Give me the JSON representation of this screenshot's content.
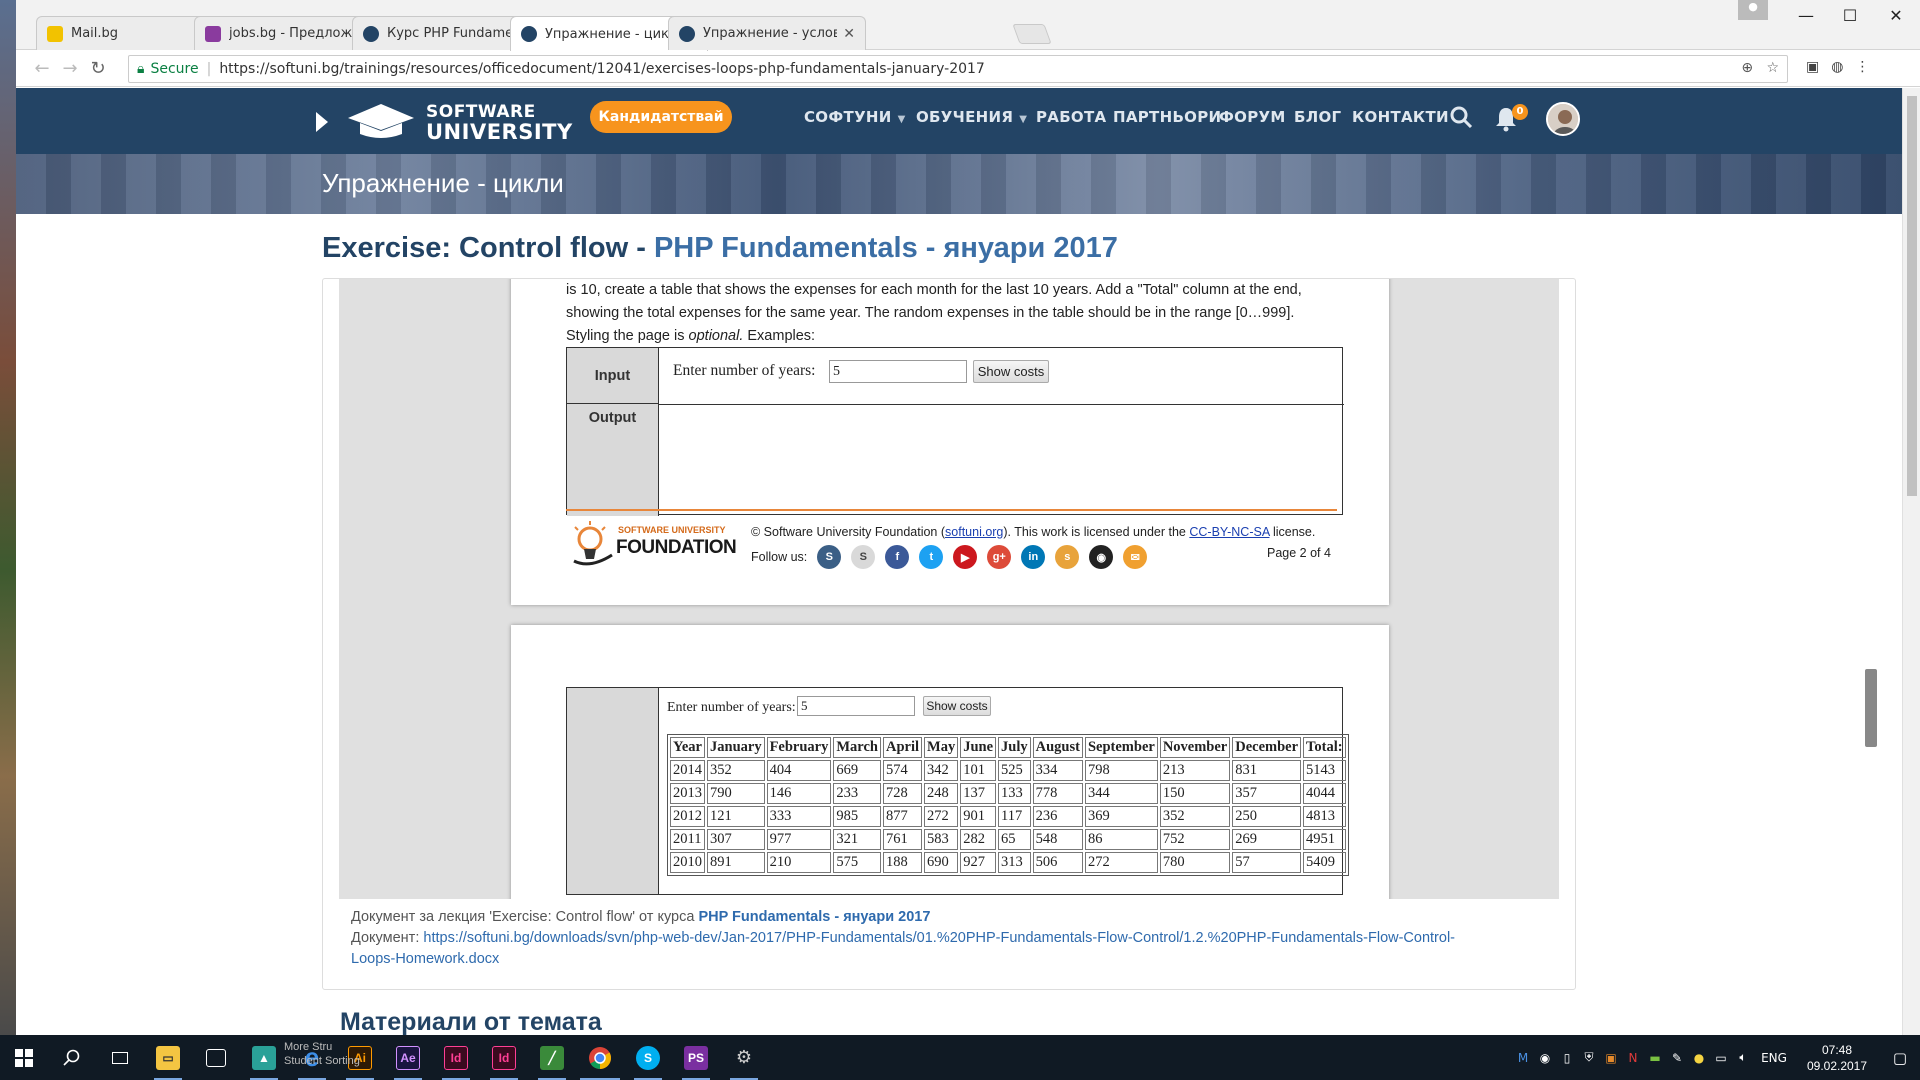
{
  "browser": {
    "tabs": [
      {
        "title": "Mail.bg",
        "color": "#f2c200"
      },
      {
        "title": "jobs.bg - Предложения",
        "color": "#8a3b9e"
      },
      {
        "title": "Курс PHP Fundamentals",
        "color": "#234465"
      },
      {
        "title": "Упражнение - цикли - С",
        "color": "#234465"
      },
      {
        "title": "Упражнение - условни",
        "color": "#234465"
      }
    ],
    "secure_label": "Secure",
    "url": "https://softuni.bg/trainings/resources/officedocument/12041/exercises-loops-php-fundamentals-january-2017"
  },
  "site": {
    "logo_line1": "SOFTWARE",
    "logo_line2": "UNIVERSITY",
    "apply_button": "Кандидатствай",
    "nav": [
      {
        "label": "СОФТУНИ",
        "dropdown": true
      },
      {
        "label": "ОБУЧЕНИЯ",
        "dropdown": true
      },
      {
        "label": "РАБОТА",
        "dropdown": false
      },
      {
        "label": "ПАРТНЬОРИ",
        "dropdown": false
      },
      {
        "label": "ФОРУМ",
        "dropdown": false
      },
      {
        "label": "БЛОГ",
        "dropdown": false
      },
      {
        "label": "КОНТАКТИ",
        "dropdown": false
      }
    ],
    "notification_count": "0",
    "banner_title": "Упражнение - цикли",
    "accent": "#f7941d",
    "header_bg": "#234465"
  },
  "page": {
    "heading_prefix": "Exercise: Control flow - ",
    "heading_course": "PHP Fundamentals - януари 2017"
  },
  "doc": {
    "page2": {
      "text_line_cut": "is 10, create a table that shows the expenses for each month for the last 10 years. Add a \"Total\" column at the end,",
      "text_line1": "showing the total expenses for the same year. The random expenses in the table should be in the range [0…999].",
      "text_line2_a": "Styling the page is ",
      "text_line2_em": "optional.",
      "text_line2_b": " Examples:",
      "input_label": "Input",
      "output_label": "Output",
      "years_label": "Enter number of years:",
      "years_value": "5",
      "button": "Show costs",
      "foundation_l1": "SOFTWARE UNIVERSITY",
      "foundation_l2": "FOUNDATION",
      "copyright_a": "© Software University Foundation (",
      "copyright_link1": "softuni.org",
      "copyright_b": "). This work is licensed under the ",
      "copyright_link2": "CC-BY-NC-SA",
      "copyright_c": " license.",
      "follow_us": "Follow us:",
      "page_number": "Page 2 of 4",
      "social": [
        {
          "name": "softuni-icon",
          "color": "#3b5f86",
          "glyph": "S"
        },
        {
          "name": "softuni-alt-icon",
          "color": "#d9d9d9",
          "glyph": "S"
        },
        {
          "name": "facebook-icon",
          "color": "#3b5998",
          "glyph": "f"
        },
        {
          "name": "twitter-icon",
          "color": "#1da1f2",
          "glyph": "t"
        },
        {
          "name": "youtube-icon",
          "color": "#cc181e",
          "glyph": "▶"
        },
        {
          "name": "google-plus-icon",
          "color": "#dd4b39",
          "glyph": "g+"
        },
        {
          "name": "linkedin-icon",
          "color": "#0077b5",
          "glyph": "in"
        },
        {
          "name": "slideshare-icon",
          "color": "#e8a33b",
          "glyph": "s"
        },
        {
          "name": "github-icon",
          "color": "#222222",
          "glyph": "◉"
        },
        {
          "name": "email-icon",
          "color": "#f0a030",
          "glyph": "✉"
        }
      ]
    },
    "page3": {
      "years_label": "Enter number of years:",
      "years_value": "5",
      "button": "Show costs",
      "table_headers": [
        "Year",
        "January",
        "February",
        "March",
        "April",
        "May",
        "June",
        "July",
        "August",
        "September",
        "November",
        "December",
        "Total:"
      ],
      "table_rows": [
        [
          "2014",
          "352",
          "404",
          "669",
          "574",
          "342",
          "101",
          "525",
          "334",
          "798",
          "213",
          "831",
          "5143"
        ],
        [
          "2013",
          "790",
          "146",
          "233",
          "728",
          "248",
          "137",
          "133",
          "778",
          "344",
          "150",
          "357",
          "4044"
        ],
        [
          "2012",
          "121",
          "333",
          "985",
          "877",
          "272",
          "901",
          "117",
          "236",
          "369",
          "352",
          "250",
          "4813"
        ],
        [
          "2011",
          "307",
          "977",
          "321",
          "761",
          "583",
          "282",
          "65",
          "548",
          "86",
          "752",
          "269",
          "4951"
        ],
        [
          "2010",
          "891",
          "210",
          "575",
          "188",
          "690",
          "927",
          "313",
          "506",
          "272",
          "780",
          "57",
          "5409"
        ]
      ]
    },
    "info_prefix": "Документ за лекция 'Exercise: Control flow' от курса ",
    "info_course": "PHP Fundamentals - януари 2017",
    "doc_label": "Документ: ",
    "doc_url_line1": "https://softuni.bg/downloads/svn/php-web-dev/Jan-2017/PHP-Fundamentals/01.%20PHP-Fundamentals-Flow-Control/1.2.%20PHP-Fundamentals-Flow-Control-",
    "doc_url_line2": "Loops-Homework.docx"
  },
  "materials_heading": "Материали от темата",
  "taskbar": {
    "hidden_window_line1": "More Stru",
    "hidden_window_line2": "Student Sorting",
    "language": "ENG",
    "time": "07:48",
    "date": "09.02.2017"
  }
}
